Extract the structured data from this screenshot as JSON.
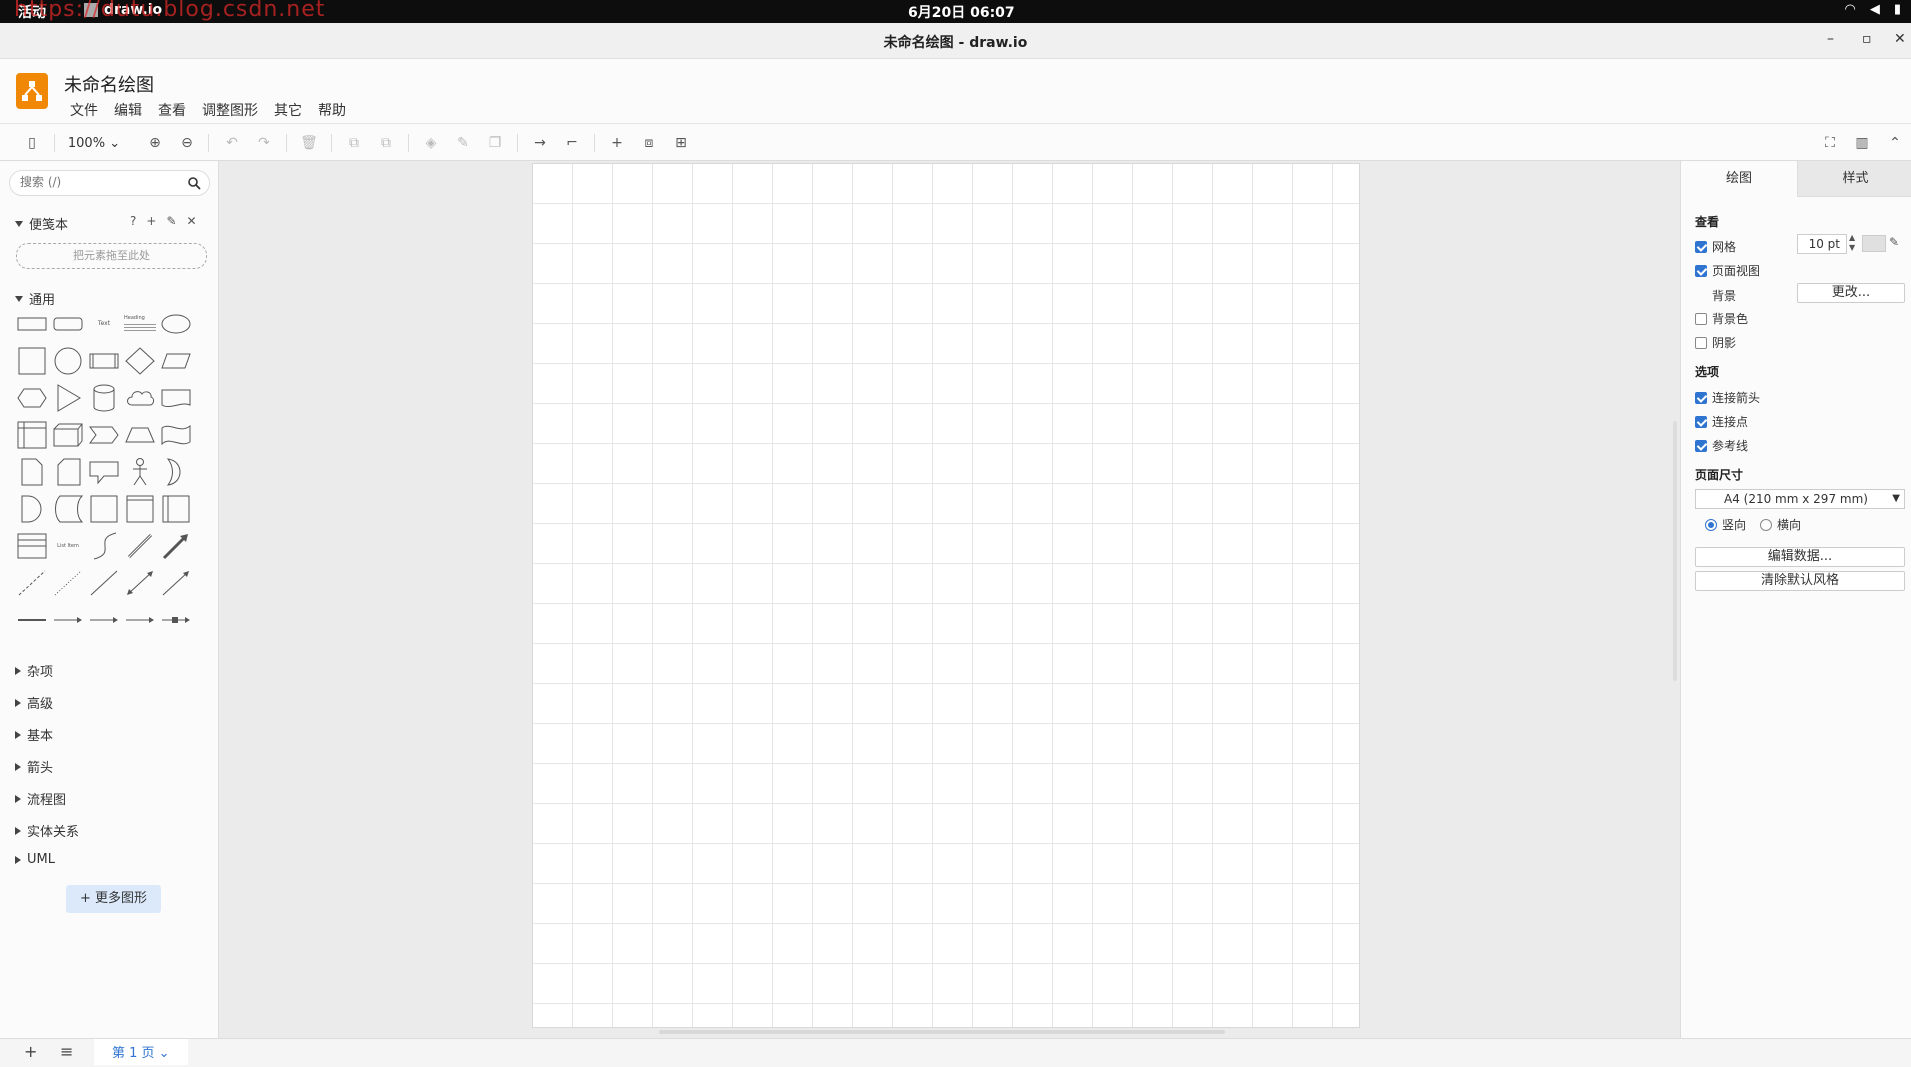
{
  "system": {
    "activities": "活动",
    "app_name": "draw.io",
    "clock": "6月20日 06:07",
    "watermark": "https://dutu.blog.csdn.net"
  },
  "window": {
    "title": "未命名绘图 - draw.io",
    "minimize": "–",
    "maximize": "▫",
    "close": "✕"
  },
  "app": {
    "doc_title": "未命名绘图",
    "menu": [
      "文件",
      "编辑",
      "查看",
      "调整图形",
      "其它",
      "帮助"
    ]
  },
  "toolbar": {
    "zoom": "100%"
  },
  "sidebar": {
    "search_placeholder": "搜索 (/)",
    "scratchpad": "便笺本",
    "dropzone": "把元素拖至此处",
    "general": "通用",
    "text_shape": "Text",
    "heading_shape": "Heading",
    "list_shape": "List Item",
    "collapsed_sections": [
      "杂项",
      "高级",
      "基本",
      "箭头",
      "流程图",
      "实体关系",
      "UML"
    ],
    "more_shapes": "+ 更多图形"
  },
  "panel": {
    "tab_diagram": "绘图",
    "tab_style": "样式",
    "view_heading": "查看",
    "grid": {
      "label": "网格",
      "checked": true,
      "size": "10 pt"
    },
    "page_view": {
      "label": "页面视图",
      "checked": true
    },
    "background_label": "背景",
    "change_button": "更改...",
    "background_color": {
      "label": "背景色",
      "checked": false
    },
    "shadow": {
      "label": "阴影",
      "checked": false
    },
    "options_heading": "选项",
    "connection_arrows": {
      "label": "连接箭头",
      "checked": true
    },
    "connection_points": {
      "label": "连接点",
      "checked": true
    },
    "guides": {
      "label": "参考线",
      "checked": true
    },
    "page_size_heading": "页面尺寸",
    "page_size_value": "A4 (210 mm x 297 mm)",
    "portrait": "竖向",
    "landscape": "横向",
    "orientation_selected": "portrait",
    "edit_data": "编辑数据...",
    "clear_style": "清除默认风格"
  },
  "footer": {
    "add_page": "+",
    "pages_menu": "≡",
    "page_tab": "第 1 页"
  },
  "colors": {
    "accent": "#2f74d0",
    "logo": "#f08705"
  }
}
